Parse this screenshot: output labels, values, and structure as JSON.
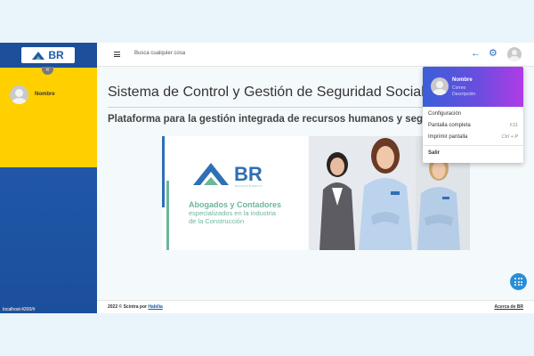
{
  "brand": {
    "logo_text": "BR"
  },
  "sidebar": {
    "user_name": "Nombre",
    "toggle_glyph": "«"
  },
  "navbar": {
    "search_placeholder": "Busca cualquier cosa",
    "back_glyph": "←",
    "settings_glyph": "⚙"
  },
  "main": {
    "title": "Sistema de Control y Gestión de Seguridad Social",
    "subtitle": "Plataforma para la gestión integrada de recursos humanos y seguridad social",
    "banner": {
      "logo_text": "BR",
      "logo_sub": "MANAGEMENT",
      "tagline1": "Abogados y Contadores",
      "tagline2": "especializados en la industria",
      "tagline3": "de la Construcción",
      "badge_text": "BR"
    }
  },
  "footer": {
    "copyright": "2022 © Scintra por",
    "link": "Habilia",
    "about": "Acerca de BR"
  },
  "status": {
    "url": "localhost:4200/#"
  },
  "user_menu": {
    "name": "Nombre",
    "email": "Correo",
    "description": "Descripción",
    "items": [
      {
        "label": "Configuración",
        "shortcut": ""
      },
      {
        "label": "Pantalla completa",
        "shortcut": "F11"
      },
      {
        "label": "Imprimir pantalla",
        "shortcut": "Ctrl + P"
      }
    ],
    "logout": "Salir"
  },
  "colors": {
    "sidebar": "#1f55a5",
    "sidebar_user_bg": "#ffd000",
    "accent": "#2a6fc9",
    "banner_blue": "#2f6fb6",
    "banner_green": "#6cb69a",
    "menu_gradient_start": "#3a5fd8",
    "menu_gradient_end": "#b03be6"
  },
  "icons": [
    "hamburger-menu-icon",
    "back-arrow-icon",
    "gear-icon",
    "avatar-icon",
    "apps-grid-icon"
  ]
}
